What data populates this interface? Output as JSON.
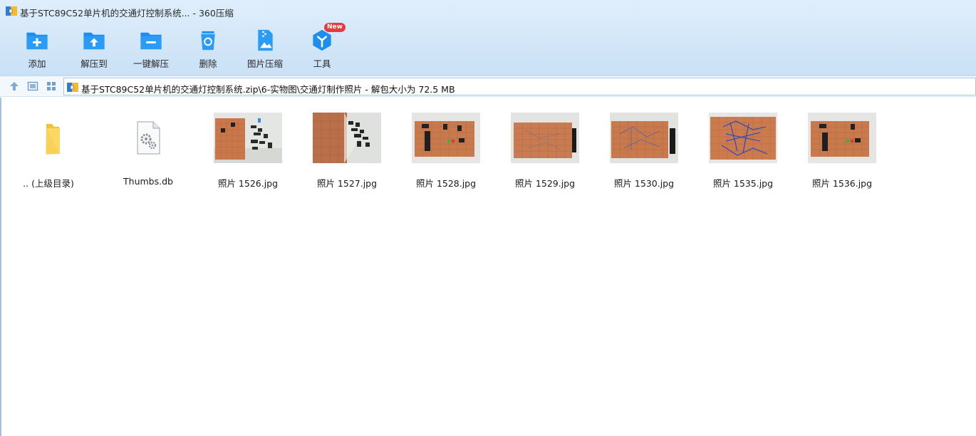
{
  "window": {
    "title": "基于STC89C52单片机的交通灯控制系统... - 360压缩"
  },
  "toolbar": {
    "items": [
      {
        "label": "添加",
        "icon": "add-folder-icon"
      },
      {
        "label": "解压到",
        "icon": "extract-to-icon"
      },
      {
        "label": "一键解压",
        "icon": "one-click-extract-icon"
      },
      {
        "label": "删除",
        "icon": "recycle-bin-icon"
      },
      {
        "label": "图片压缩",
        "icon": "image-compress-icon"
      },
      {
        "label": "工具",
        "icon": "tools-icon",
        "badge": "New"
      }
    ]
  },
  "address": {
    "path": "基于STC89C52单片机的交通灯控制系统.zip\\6-实物图\\交通灯制作照片 - 解包大小为 72.5 MB"
  },
  "files": [
    {
      "name": ".. (上级目录)",
      "type": "parent-folder"
    },
    {
      "name": "Thumbs.db",
      "type": "system-file"
    },
    {
      "name": "照片 1526.jpg",
      "type": "image"
    },
    {
      "name": "照片 1527.jpg",
      "type": "image"
    },
    {
      "name": "照片 1528.jpg",
      "type": "image"
    },
    {
      "name": "照片 1529.jpg",
      "type": "image"
    },
    {
      "name": "照片 1530.jpg",
      "type": "image"
    },
    {
      "name": "照片 1535.jpg",
      "type": "image"
    },
    {
      "name": "照片 1536.jpg",
      "type": "image"
    }
  ],
  "colors": {
    "accent": "#1e8fe6",
    "toolbar_bg": "#d2e6f8",
    "pcb": "#c9784b",
    "badge": "#e83a3a"
  }
}
